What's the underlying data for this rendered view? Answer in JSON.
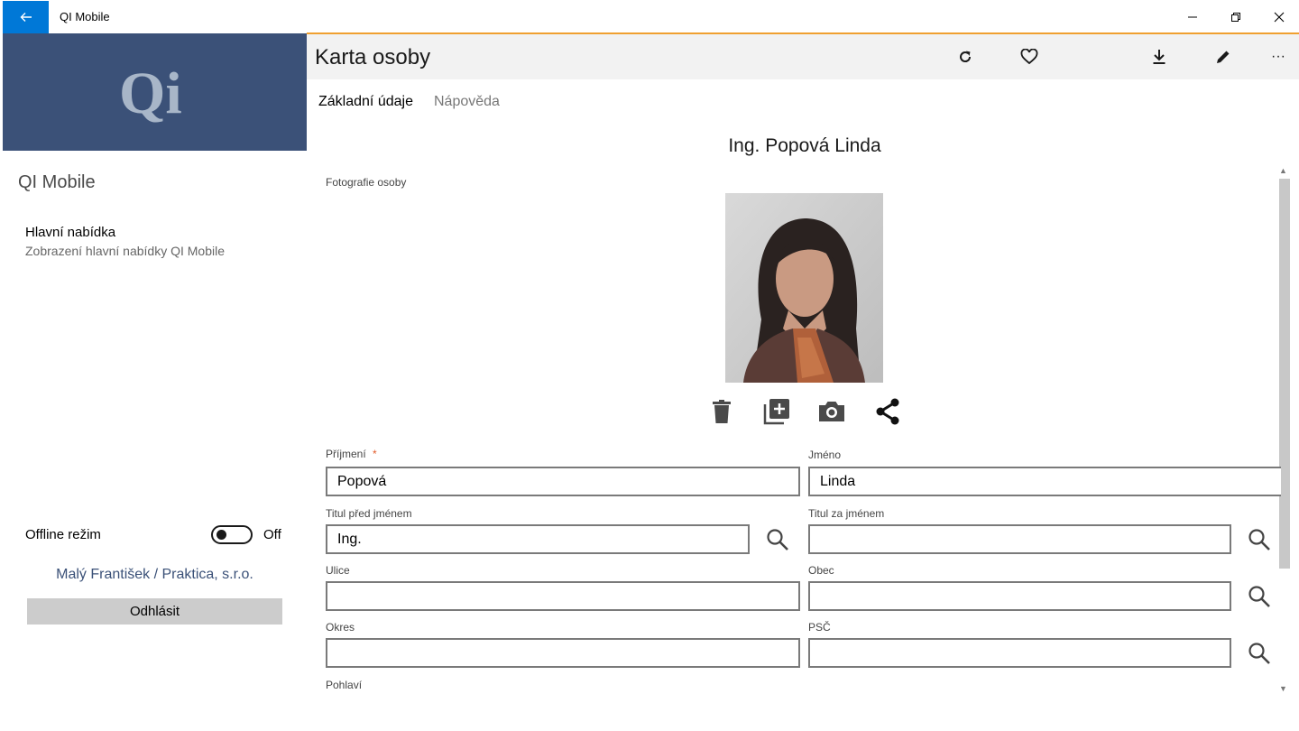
{
  "titlebar": {
    "app_title": "QI Mobile",
    "back_icon": "arrow-left-icon",
    "controls": [
      "minimize-icon",
      "restore-icon",
      "close-icon"
    ]
  },
  "colors": {
    "accent_blue": "#0078d7",
    "logo_bg": "#3b5178",
    "accent_line": "#f0a030",
    "required_mark": "#e25b2a",
    "logout_bg": "#cccccc"
  },
  "sidebar": {
    "logo_text": "Qi",
    "app_name": "QI Mobile",
    "menu_item": {
      "title": "Hlavní nabídka",
      "description": "Zobrazení hlavní nabídky QI Mobile"
    },
    "offline": {
      "label": "Offline režim",
      "state": "Off",
      "on": false
    },
    "user": "Malý František / Praktica, s.r.o.",
    "logout_label": "Odhlásit"
  },
  "header": {
    "title": "Karta osoby",
    "icons": [
      "refresh-icon",
      "heart-icon",
      "download-icon",
      "edit-icon",
      "more-icon"
    ],
    "more_label": "···"
  },
  "tabs": [
    {
      "label": "Základní údaje",
      "active": true
    },
    {
      "label": "Nápověda",
      "active": false
    }
  ],
  "person": {
    "full_name": "Ing. Popová Linda",
    "photo_label": "Fotografie osoby",
    "photo_actions": [
      "delete-icon",
      "add-photo-icon",
      "camera-icon",
      "share-icon"
    ]
  },
  "form": {
    "prijmeni": {
      "label": "Příjmení",
      "required_mark": "*",
      "value": "Popová"
    },
    "jmeno": {
      "label": "Jméno",
      "value": "Linda"
    },
    "titul_pred": {
      "label": "Titul před jménem",
      "value": "Ing."
    },
    "titul_za": {
      "label": "Titul za jménem",
      "value": ""
    },
    "ulice": {
      "label": "Ulice",
      "value": ""
    },
    "obec": {
      "label": "Obec",
      "value": ""
    },
    "okres": {
      "label": "Okres",
      "value": ""
    },
    "psc": {
      "label": "PSČ",
      "value": ""
    },
    "pohlavi": {
      "label": "Pohlaví"
    }
  }
}
